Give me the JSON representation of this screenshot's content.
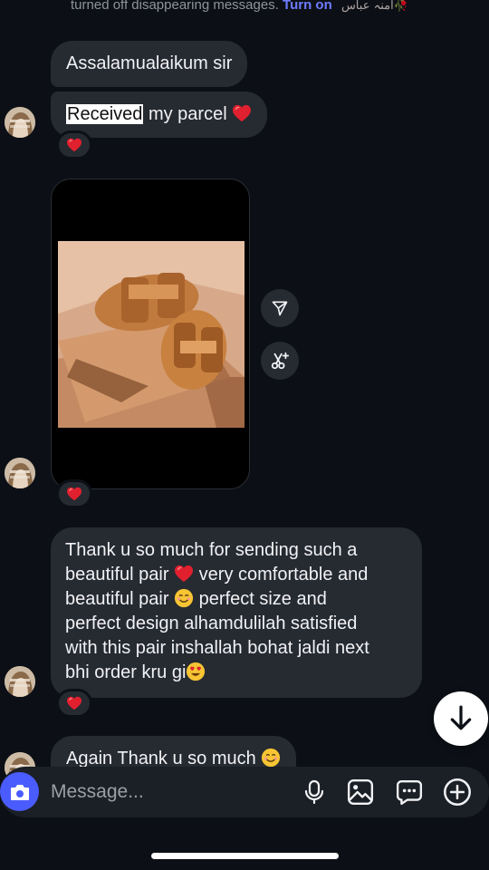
{
  "header": {
    "note": "turned off disappearing messages.",
    "turn_on": "Turn on",
    "signature": "امنہ عباس🥀"
  },
  "messages": [
    {
      "text": "Assalamualaikum sir"
    },
    {
      "highlight": "Received",
      "text_after": " my parcel",
      "emoji": "❤️",
      "reaction": "❤️"
    },
    {
      "type": "photo",
      "reaction": "❤️",
      "actions": [
        "share-icon",
        "scissors-sparkle-icon"
      ]
    },
    {
      "lines": [
        "Thank u so much for sending such a",
        "beautiful pair",
        "very comfortable and",
        "beautiful pair",
        "perfect size and",
        "perfect design alhamdulilah satisfied",
        "with this pair inshallah bohat jaldi next",
        "bhi order kru gi"
      ],
      "reaction": "❤️"
    },
    {
      "text": "Again Thank u so much"
    }
  ],
  "composer": {
    "placeholder": "Message...",
    "icons": [
      "camera-icon",
      "microphone-icon",
      "gallery-icon",
      "sticker-icon",
      "plus-icon"
    ]
  },
  "colors": {
    "background": "#0c1016",
    "bubble": "#262a31",
    "accent": "#4b5cff",
    "link": "#6e7bff",
    "heart": "#e0202e"
  }
}
